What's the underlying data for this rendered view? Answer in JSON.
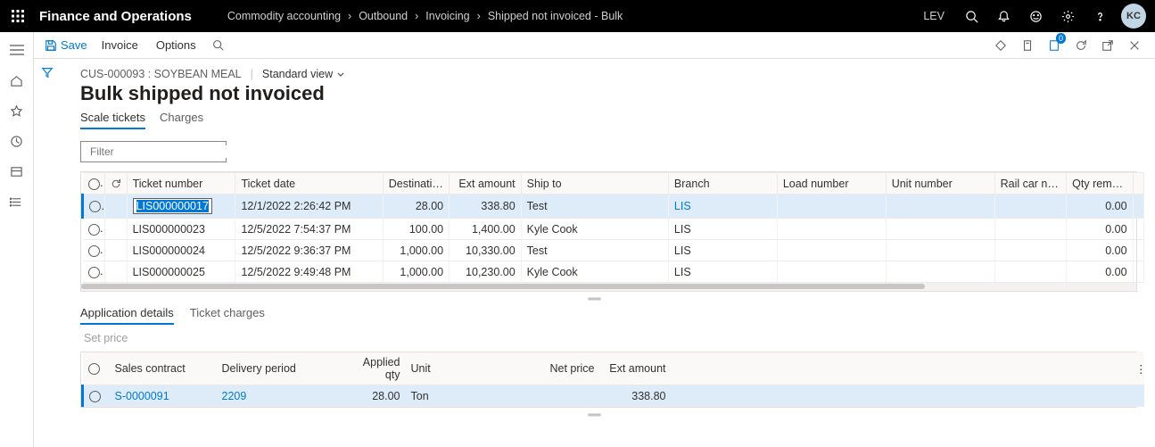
{
  "header": {
    "app_title": "Finance and Operations",
    "breadcrumbs": [
      "Commodity accounting",
      "Outbound",
      "Invoicing",
      "Shipped not invoiced - Bulk"
    ],
    "environment": "LEV",
    "user_initials": "KC"
  },
  "actionbar": {
    "save": "Save",
    "items": [
      "Invoice",
      "Options"
    ],
    "badge_count": "0"
  },
  "page": {
    "context": "CUS-000093 : SOYBEAN MEAL",
    "view_label": "Standard view",
    "title": "Bulk shipped not invoiced",
    "tabs": [
      "Scale tickets",
      "Charges"
    ],
    "active_tab": 0,
    "filter_placeholder": "Filter"
  },
  "grid": {
    "columns": [
      "Ticket number",
      "Ticket date",
      "Destination gr...",
      "Ext amount",
      "Ship to",
      "Branch",
      "Load number",
      "Unit number",
      "Rail car number",
      "Qty remainin"
    ],
    "rows": [
      {
        "ticket": "LIS000000017",
        "date": "12/1/2022 2:26:42 PM",
        "dest": "28.00",
        "ext": "338.80",
        "shipto": "Test",
        "branch": "LIS",
        "load": "",
        "unit": "",
        "rail": "",
        "qty": "0.00",
        "selected": true,
        "editing": true
      },
      {
        "ticket": "LIS000000023",
        "date": "12/5/2022 7:54:37 PM",
        "dest": "100.00",
        "ext": "1,400.00",
        "shipto": "Kyle Cook",
        "branch": "LIS",
        "load": "",
        "unit": "",
        "rail": "",
        "qty": "0.00"
      },
      {
        "ticket": "LIS000000024",
        "date": "12/5/2022 9:36:37 PM",
        "dest": "1,000.00",
        "ext": "10,330.00",
        "shipto": "Test",
        "branch": "LIS",
        "load": "",
        "unit": "",
        "rail": "",
        "qty": "0.00"
      },
      {
        "ticket": "LIS000000025",
        "date": "12/5/2022 9:49:48 PM",
        "dest": "1,000.00",
        "ext": "10,230.00",
        "shipto": "Kyle Cook",
        "branch": "LIS",
        "load": "",
        "unit": "",
        "rail": "",
        "qty": "0.00"
      }
    ]
  },
  "details": {
    "tabs": [
      "Application details",
      "Ticket charges"
    ],
    "active_tab": 0,
    "set_price_label": "Set price",
    "columns": [
      "Sales contract",
      "Delivery period",
      "Applied qty",
      "Unit",
      "Net price",
      "Ext amount"
    ],
    "rows": [
      {
        "contract": "S-0000091",
        "period": "2209",
        "applied": "28.00",
        "unit": "Ton",
        "net": "",
        "ext": "338.80",
        "selected": true
      }
    ]
  }
}
